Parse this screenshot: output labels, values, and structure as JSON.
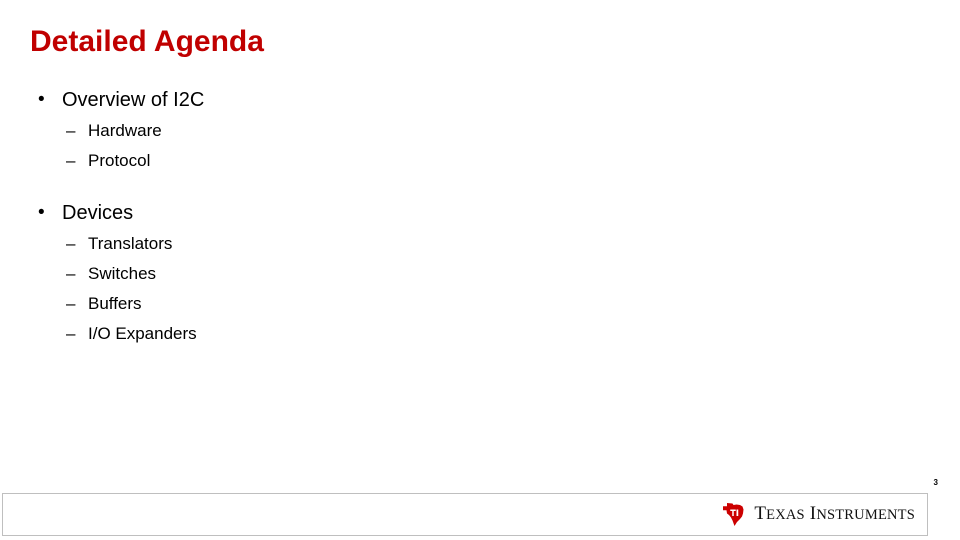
{
  "slide": {
    "title": "Detailed Agenda",
    "title_color": "#C00000",
    "background_color": "#FFFFFF",
    "page_number": "3"
  },
  "content": {
    "groups": [
      {
        "bullet_marker": "•",
        "label": "Overview of I2C",
        "sub_marker": "–",
        "sub_items": [
          {
            "label": "Hardware"
          },
          {
            "label": "Protocol"
          }
        ]
      },
      {
        "bullet_marker": "•",
        "label": "Devices",
        "sub_marker": "–",
        "sub_items": [
          {
            "label": "Translators"
          },
          {
            "label": "Switches"
          },
          {
            "label": "Buffers"
          },
          {
            "label": "I/O Expanders"
          }
        ]
      }
    ]
  },
  "footer": {
    "logo": {
      "mark_name": "texas-shape-icon",
      "mark_color": "#CC0000",
      "monogram": "TI",
      "wordmark_first_cap": "T",
      "wordmark_first_rest": "EXAS",
      "wordmark_second_cap": "I",
      "wordmark_second_rest": "NSTRUMENTS",
      "wordmark_full": "TEXAS INSTRUMENTS"
    },
    "border_color": "#BFBFBF"
  }
}
